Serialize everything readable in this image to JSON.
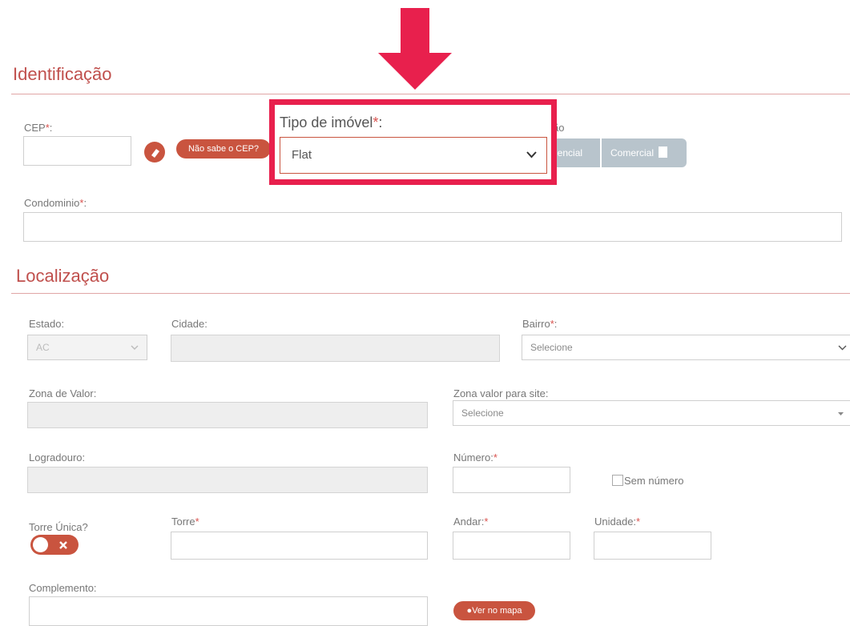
{
  "annotation": {
    "arrow_color": "#e8204d",
    "highlight_color": "#e8204d"
  },
  "identificacao": {
    "title": "Identificação",
    "cep_label": "CEP",
    "required_mark": "*",
    "label_colon": ":",
    "cep_value": "",
    "nao_sabe_cep_label": "Não sabe o CEP?",
    "tipo_imovel_label": "Tipo de imóvel",
    "tipo_imovel_value": "Flat",
    "finalidade_partial_label": "ão",
    "residencial_partial_label": "dencial",
    "comercial_label": "Comercial",
    "condominio_label": "Condominio",
    "condominio_value": ""
  },
  "localizacao": {
    "title": "Localização",
    "estado_label": "Estado:",
    "estado_value": "AC",
    "cidade_label": "Cidade:",
    "bairro_label": "Bairro",
    "bairro_value": "Selecione",
    "zona_valor_label": "Zona de Valor:",
    "zona_site_label": "Zona valor para site:",
    "zona_site_value": "Selecione",
    "logradouro_label": "Logradouro:",
    "numero_label": "Número:",
    "sem_numero_label": "Sem número",
    "torre_unica_label": "Torre Única?",
    "torre_unica_on": false,
    "torre_label": "Torre",
    "andar_label": "Andar:",
    "unidade_label": "Unidade:",
    "complemento_label": "Complemento:",
    "ver_mapa_label": "Ver no mapa"
  }
}
